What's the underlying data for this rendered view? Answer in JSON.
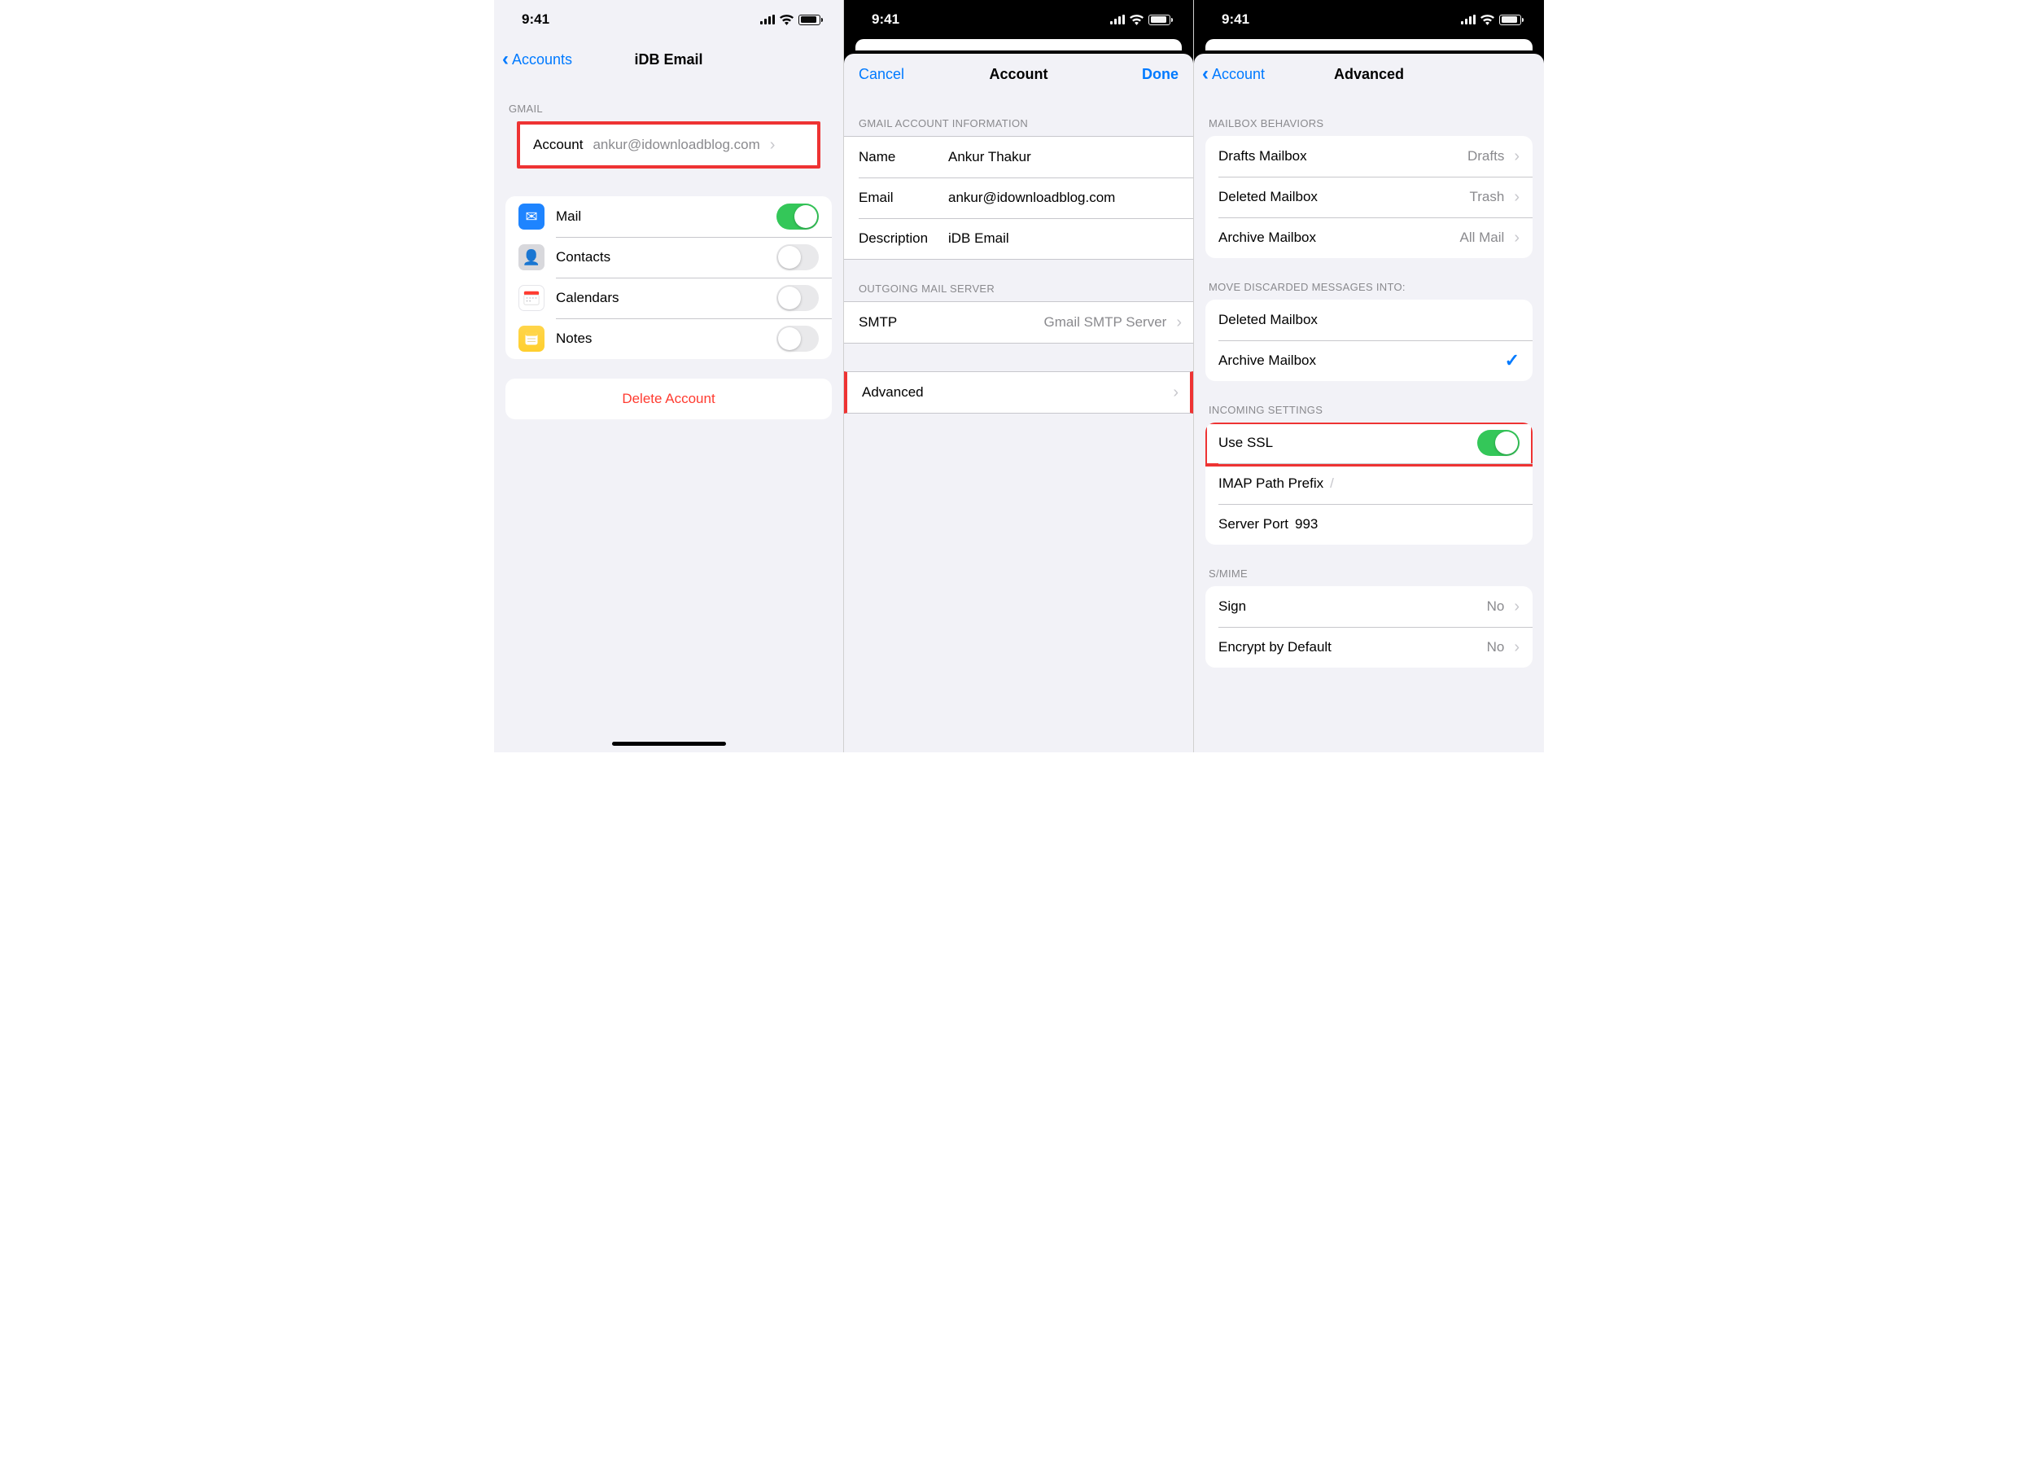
{
  "status": {
    "time": "9:41"
  },
  "screen1": {
    "back": "Accounts",
    "title": "iDB Email",
    "section_gmail": "GMAIL",
    "account_label": "Account",
    "account_value": "ankur@idownloadblog.com",
    "services": {
      "mail": "Mail",
      "contacts": "Contacts",
      "calendars": "Calendars",
      "notes": "Notes"
    },
    "delete": "Delete Account"
  },
  "screen2": {
    "cancel": "Cancel",
    "title": "Account",
    "done": "Done",
    "section_info": "GMAIL ACCOUNT INFORMATION",
    "name_label": "Name",
    "name_value": "Ankur Thakur",
    "email_label": "Email",
    "email_value": "ankur@idownloadblog.com",
    "desc_label": "Description",
    "desc_value": "iDB Email",
    "section_out": "OUTGOING MAIL SERVER",
    "smtp_label": "SMTP",
    "smtp_value": "Gmail SMTP Server",
    "advanced": "Advanced"
  },
  "screen3": {
    "back": "Account",
    "title": "Advanced",
    "section_behaviors": "MAILBOX BEHAVIORS",
    "drafts_label": "Drafts Mailbox",
    "drafts_value": "Drafts",
    "deleted_label": "Deleted Mailbox",
    "deleted_value": "Trash",
    "archive_label": "Archive Mailbox",
    "archive_value": "All Mail",
    "section_move": "MOVE DISCARDED MESSAGES INTO:",
    "move_deleted": "Deleted Mailbox",
    "move_archive": "Archive Mailbox",
    "section_incoming": "INCOMING SETTINGS",
    "ssl_label": "Use SSL",
    "imap_label": "IMAP Path Prefix",
    "imap_value": "/",
    "port_label": "Server Port",
    "port_value": "993",
    "section_smime": "S/MIME",
    "sign_label": "Sign",
    "sign_value": "No",
    "encrypt_label": "Encrypt by Default",
    "encrypt_value": "No"
  }
}
